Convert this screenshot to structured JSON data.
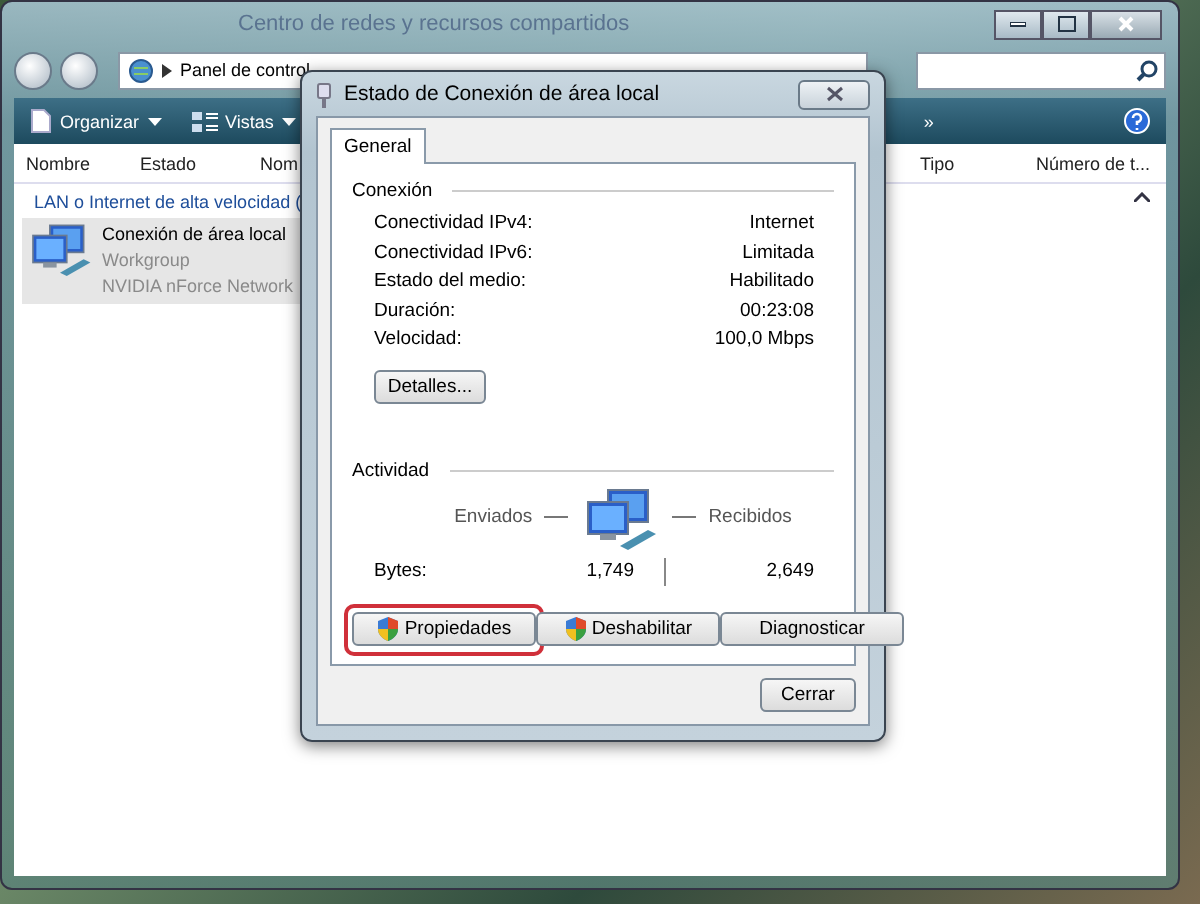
{
  "explorer": {
    "title": "Centro de redes y recursos compartidos",
    "address": "Panel de control",
    "toolbar": [
      "Organizar",
      "Vistas"
    ],
    "toolbar_more": "»",
    "columns": [
      "Nombre",
      "Estado",
      "Nom",
      "Tipo",
      "Número de t..."
    ],
    "group": "LAN o Internet de alta velocidad (",
    "items": [
      {
        "name": "Conexión de área local",
        "lines": [
          "Workgroup",
          "NVIDIA nForce Network"
        ],
        "selected": true
      }
    ]
  },
  "dialog": {
    "title": "Estado de Conexión de área local",
    "tabs": [
      {
        "label": "General",
        "selected": true
      }
    ],
    "connection": {
      "heading": "Conexión",
      "rows": [
        {
          "label": "Conectividad IPv4:",
          "value": "Internet"
        },
        {
          "label": "Conectividad IPv6:",
          "value": "Limitada"
        },
        {
          "label": "Estado del medio:",
          "value": "Habilitado"
        },
        {
          "label": "Duración:",
          "value": "00:23:08"
        },
        {
          "label": "Velocidad:",
          "value": "100,0 Mbps"
        }
      ],
      "details_button": "Detalles..."
    },
    "activity": {
      "heading": "Actividad",
      "sent": "Enviados",
      "received": "Recibidos",
      "bytes_label": "Bytes:",
      "bytes_sent": "1,749",
      "bytes_received": "2,649"
    },
    "buttons": [
      {
        "label": "Propiedades",
        "shield": true,
        "highlighted": true
      },
      {
        "label": "Deshabilitar",
        "shield": true,
        "highlighted": false
      },
      {
        "label": "Diagnosticar",
        "shield": false,
        "highlighted": false
      }
    ],
    "close_button": "Cerrar"
  }
}
